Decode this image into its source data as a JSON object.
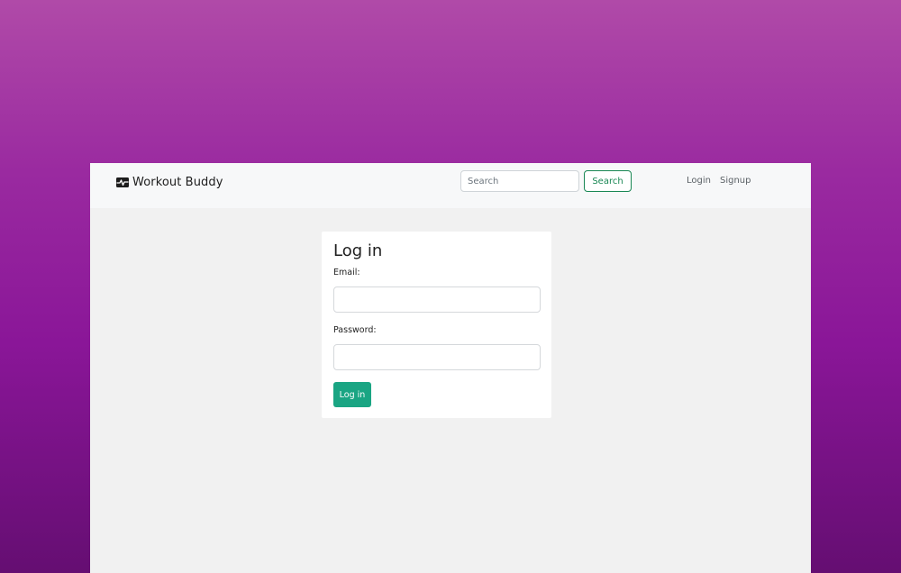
{
  "navbar": {
    "brand_icon": "heart-pulse-icon",
    "brand_name": "Workout Buddy",
    "search": {
      "placeholder": "Search",
      "value": "",
      "button_label": "Search"
    },
    "links": {
      "login": "Login",
      "signup": "Signup"
    }
  },
  "login_form": {
    "title": "Log in",
    "email_label": "Email:",
    "email_value": "",
    "password_label": "Password:",
    "password_value": "",
    "submit_label": "Log in"
  },
  "colors": {
    "accent_green": "#198754",
    "submit_button": "#1aa583",
    "background_gradient_top": "#b04aa8",
    "background_gradient_bottom": "#650e72",
    "app_background": "#f1f1f1",
    "navbar_background": "#f7f8f9"
  }
}
